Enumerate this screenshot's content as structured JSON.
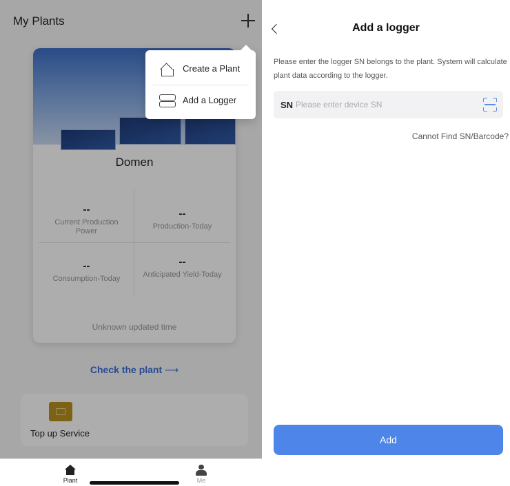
{
  "left": {
    "header_title": "My Plants",
    "plant": {
      "name": "Domen",
      "metrics": [
        {
          "value": "--",
          "label": "Current Production Power"
        },
        {
          "value": "--",
          "label": "Production-Today"
        },
        {
          "value": "--",
          "label": "Consumption-Today"
        },
        {
          "value": "--",
          "label": "Anticipated Yield-Today"
        }
      ],
      "updated": "Unknown updated time"
    },
    "check_plant": "Check the plant",
    "check_arrow": "⟶",
    "topup_label": "Top up Service",
    "tabs": [
      {
        "label": "Plant",
        "icon": "house-icon"
      },
      {
        "label": "Me",
        "icon": "user-icon"
      }
    ],
    "dropdown": [
      {
        "label": "Create a Plant",
        "icon": "house-plus-icon"
      },
      {
        "label": "Add a Logger",
        "icon": "logger-icon"
      }
    ]
  },
  "right": {
    "title": "Add a logger",
    "description": "Please enter the logger SN belongs to the plant. System will calculate plant data according to the logger.",
    "sn_label": "SN",
    "sn_placeholder": "Please enter device SN",
    "sn_value": "",
    "cannot_find": "Cannot Find SN/Barcode?",
    "add_label": "Add"
  },
  "colors": {
    "accent": "#4d86e8",
    "link": "#3a6fd8",
    "topup_icon": "#b98f1e"
  }
}
